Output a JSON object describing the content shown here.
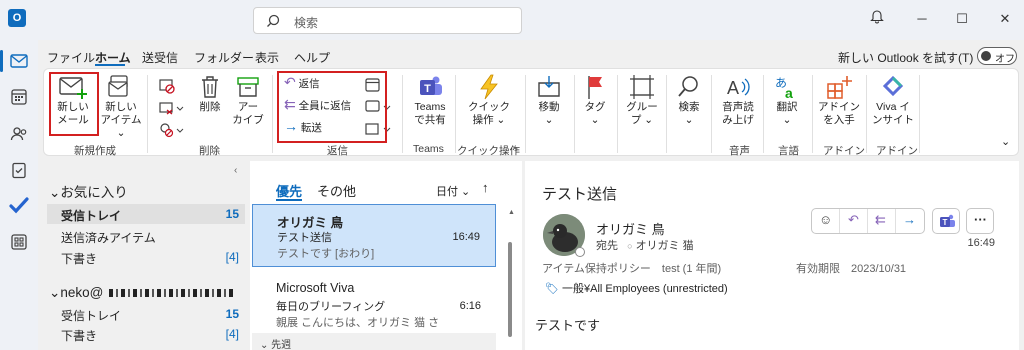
{
  "search": {
    "placeholder": "検索"
  },
  "menu": {
    "tabs": [
      "ファイル",
      "ホーム",
      "送受信",
      "フォルダー",
      "表示",
      "ヘルプ"
    ],
    "try_new": "新しい Outlook を試す(T)",
    "toggle_label": "オフ"
  },
  "ribbon": {
    "new_mail": [
      "新しい",
      "メール"
    ],
    "new_item": [
      "新しい",
      "アイテム ⌄"
    ],
    "delete": "削除",
    "archive": [
      "アー",
      "カイブ"
    ],
    "reply": "返信",
    "reply_all": "全員に返信",
    "forward": "転送",
    "teams_share": [
      "Teams",
      "で共有"
    ],
    "quick_steps": [
      "クイック",
      "操作 ⌄"
    ],
    "move": [
      "移動",
      "⌄"
    ],
    "tag": [
      "タグ",
      "⌄"
    ],
    "group": [
      "グルー",
      "プ ⌄"
    ],
    "find": [
      "検索",
      "⌄"
    ],
    "read_aloud": [
      "音声読",
      "み上げ"
    ],
    "translate": [
      "翻訳",
      "⌄"
    ],
    "get_addins": [
      "アドイン",
      "を入手"
    ],
    "viva_insights": [
      "Viva イ",
      "ンサイト"
    ],
    "groups": {
      "new": "新規作成",
      "delete": "削除",
      "reply": "返信",
      "teams": "Teams",
      "quick": "クイック操作",
      "voice": "音声",
      "language": "言語",
      "addin": "アドイン",
      "addin2": "アドイン"
    }
  },
  "folders": {
    "favorites": "お気に入り",
    "items": [
      {
        "label": "受信トレイ",
        "count": "15"
      },
      {
        "label": "送信済みアイテム",
        "count": ""
      },
      {
        "label": "下書き",
        "count": "[4]"
      }
    ],
    "account": "neko@",
    "account_items": [
      {
        "label": "受信トレイ",
        "count": "15"
      },
      {
        "label": "下書き",
        "count": "[4]"
      }
    ]
  },
  "list": {
    "tab_focused": "優先",
    "tab_other": "その他",
    "sort": "日付 ⌄",
    "messages": [
      {
        "from": "オリガミ 鳥",
        "subject": "テスト送信",
        "preview": "テストです [おわり]",
        "time": "16:49"
      },
      {
        "from": "Microsoft Viva",
        "subject": "毎日のブリーフィング",
        "preview": "親展 こんにちは、オリガミ 猫 さ",
        "time": "6:16"
      }
    ],
    "section": "⌄ 先週"
  },
  "reading": {
    "subject": "テスト送信",
    "from": "オリガミ 鳥",
    "to_label": "宛先",
    "to": "オリガミ 猫",
    "time": "16:49",
    "retention": "アイテム保持ポリシー　test (1 年間)",
    "expiry": "有効期限　2023/10/31",
    "label": "一般¥All Employees (unrestricted)",
    "body": "テストです"
  }
}
